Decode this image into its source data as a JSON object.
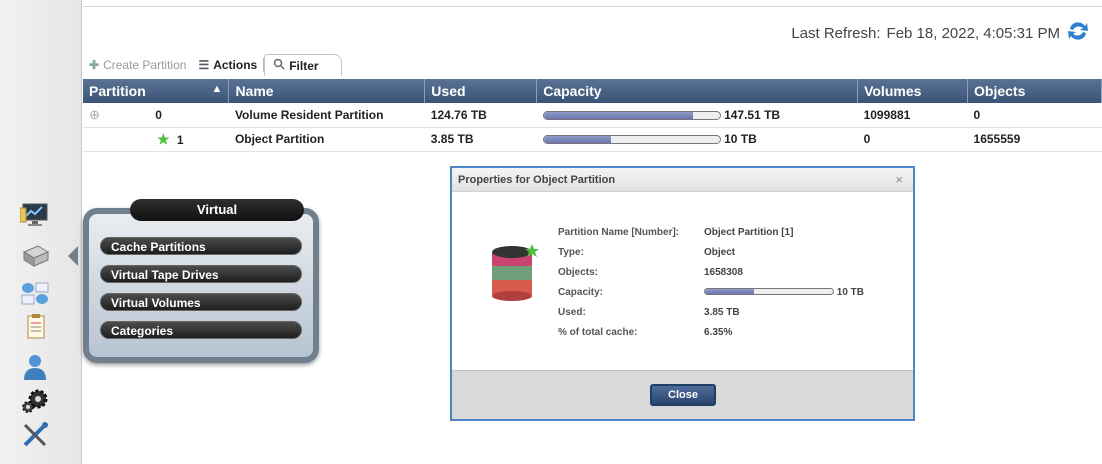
{
  "header": {
    "last_refresh_label": "Last Refresh:",
    "last_refresh_value": "Feb 18, 2022, 4:05:31 PM"
  },
  "toolbar": {
    "create_label": "Create Partition",
    "actions_label": "Actions",
    "filter_label": "Filter"
  },
  "table": {
    "columns": [
      "Partition",
      "Name",
      "Used",
      "Capacity",
      "Volumes",
      "Objects"
    ],
    "rows": [
      {
        "partition": "0",
        "name": "Volume Resident Partition",
        "used": "124.76 TB",
        "capacity": "147.51 TB",
        "capacity_fraction": 0.846,
        "volumes": "1099881",
        "objects": "0"
      },
      {
        "partition": "1",
        "name": "Object Partition",
        "used": "3.85 TB",
        "capacity": "10 TB",
        "capacity_fraction": 0.385,
        "volumes": "0",
        "objects": "1655559"
      }
    ]
  },
  "flyout": {
    "title": "Virtual",
    "items": [
      "Cache Partitions",
      "Virtual Tape Drives",
      "Virtual Volumes",
      "Categories"
    ]
  },
  "dialog": {
    "title": "Properties for Object Partition",
    "close_x": "×",
    "properties": [
      {
        "label": "Partition Name [Number]:",
        "value": "Object Partition [1]"
      },
      {
        "label": "Type:",
        "value": "Object"
      },
      {
        "label": "Objects:",
        "value": "1658308"
      },
      {
        "label": "Capacity:",
        "value": "10 TB",
        "fraction": 0.385
      },
      {
        "label": "Used:",
        "value": "3.85 TB"
      },
      {
        "label": "% of total cache:",
        "value": "6.35%"
      }
    ],
    "close_button": "Close"
  },
  "icons": {
    "refresh": "refresh-icon",
    "create": "plus-icon",
    "actions": "list-icon",
    "filter": "magnifier-icon",
    "sort": "sort-asc-icon",
    "expand": "expand-icon",
    "star": "star-icon",
    "partition_db": "database-icon"
  },
  "colors": {
    "header_bg": "#3b5477",
    "accent_blue": "#4d86c4",
    "bar_fill": "#6a76ad"
  }
}
